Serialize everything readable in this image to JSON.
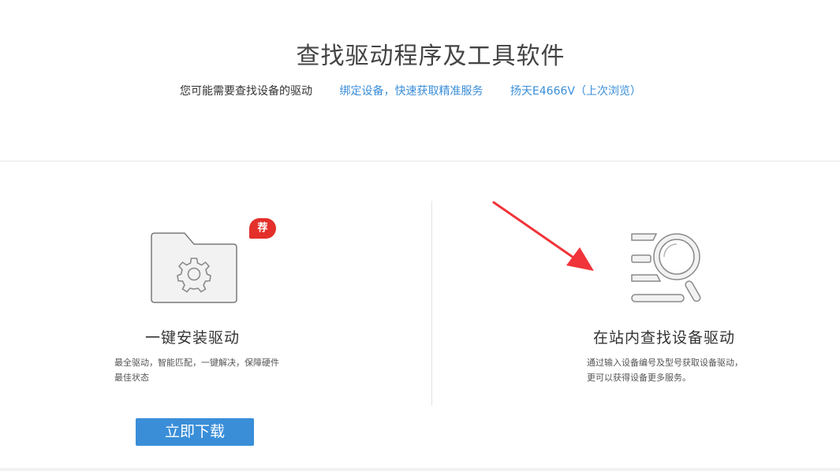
{
  "header": {
    "title": "查找驱动程序及工具软件",
    "hint": "您可能需要查找设备的驱动",
    "bind_link": "绑定设备，快速获取精准服务",
    "recent_link": "扬天E4666V（上次浏览）"
  },
  "left_card": {
    "badge": "荐",
    "title": "一键安装驱动",
    "description": "最全驱动，智能匹配，一键解决，保障硬件最佳状态",
    "button_label": "立即下载",
    "icon": "folder-gear-icon"
  },
  "right_card": {
    "title": "在站内查找设备驱动",
    "description": "通过输入设备编号及型号获取设备驱动，更可以获得设备更多服务。",
    "icon": "search-list-icon"
  },
  "colors": {
    "link": "#3a8ed8",
    "badge": "#e3302b",
    "arrow": "#f0343a"
  }
}
